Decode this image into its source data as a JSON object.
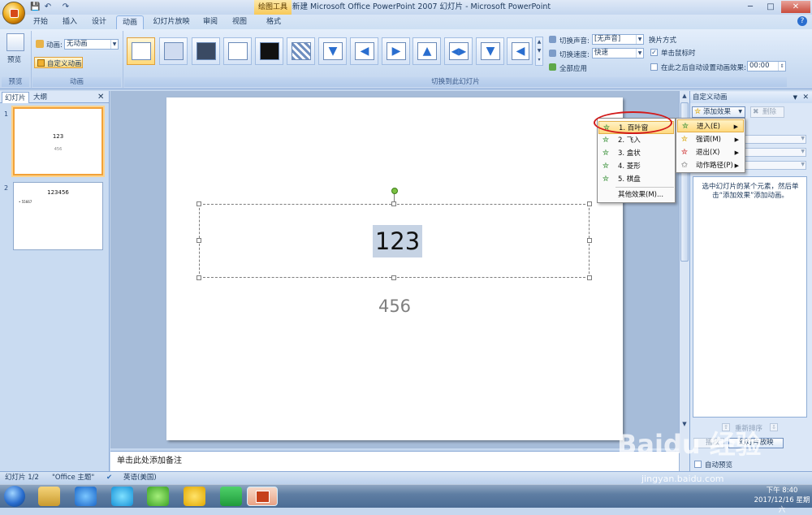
{
  "window": {
    "context_tab": "绘图工具",
    "title": "新建 Microsoft Office PowerPoint 2007 幻灯片 - Microsoft PowerPoint",
    "minimize": "─",
    "maximize": "□",
    "close": "✕"
  },
  "quick_access": [
    "💾",
    "↶",
    "↷"
  ],
  "tabs": [
    "开始",
    "插入",
    "设计",
    "动画",
    "幻灯片放映",
    "审阅",
    "视图",
    "格式"
  ],
  "active_tab": "动画",
  "help": "?",
  "ribbon": {
    "preview": {
      "label": "预览",
      "group": "预览"
    },
    "animation": {
      "label": "动画:",
      "value": "无动画",
      "custom_button": "自定义动画",
      "group": "动画"
    },
    "transition_group": "切换到此幻灯片",
    "sound_label": "切换声音:",
    "sound_value": "[无声音]",
    "speed_label": "切换速度:",
    "speed_value": "快速",
    "apply_all": "全部应用",
    "advance_title": "换片方式",
    "on_click": "单击鼠标时",
    "after_auto": "在此之后自动设置动画效果:",
    "after_time": "00:00"
  },
  "left_pane": {
    "tabs": [
      "幻灯片",
      "大纲"
    ],
    "close": "✕",
    "slides": [
      {
        "num": "1",
        "title": "123",
        "sub": "456"
      },
      {
        "num": "2",
        "title": "123456",
        "bullet": "• 55667"
      }
    ]
  },
  "slide": {
    "title": "123",
    "subtitle": "456"
  },
  "notes_placeholder": "单击此处添加备注",
  "task_pane": {
    "title": "自定义动画",
    "add_effect": "添加效果",
    "delete": "删除",
    "hint": "选中幻灯片的某个元素，然后单击“添加效果”添加动画。",
    "reorder": "重新排序",
    "play": "播放",
    "slideshow": "幻灯片放映",
    "autopreview": "自动预览"
  },
  "effect_menu": [
    {
      "label": "1. 百叶窗",
      "highlight": true
    },
    {
      "label": "2. 飞入"
    },
    {
      "label": "3. 盒状"
    },
    {
      "label": "4. 菱形"
    },
    {
      "label": "5. 棋盘"
    },
    {
      "label": "其他效果(M)..."
    }
  ],
  "category_menu": [
    {
      "label": "进入(E)",
      "icon_color": "#2e8b2e",
      "highlight": true
    },
    {
      "label": "强调(M)",
      "icon_color": "#d9a400"
    },
    {
      "label": "退出(X)",
      "icon_color": "#cc2a2a"
    },
    {
      "label": "动作路径(P)",
      "icon_color": "#555555"
    }
  ],
  "status": {
    "slide": "幻灯片 1/2",
    "theme": "\"Office 主题\"",
    "lang": "英语(美国)"
  },
  "taskbar": {
    "time": "下午 8:40",
    "date": "2017/12/16 星期六"
  },
  "watermark": {
    "logo": "Baidu 经验",
    "url": "jingyan.baidu.com"
  }
}
